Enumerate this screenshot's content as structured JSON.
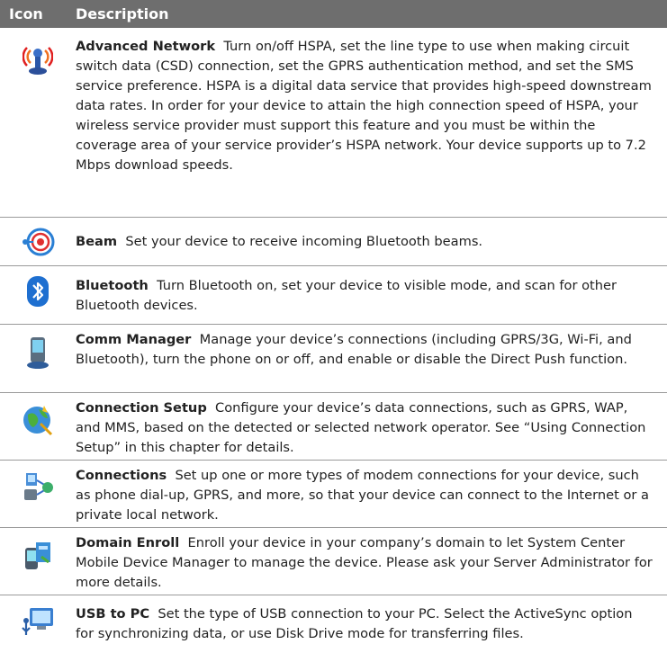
{
  "header": {
    "icon_label": "Icon",
    "description_label": "Description"
  },
  "items": [
    {
      "icon": "advanced-network-icon",
      "title": "Advanced Network",
      "text": "Turn on/off HSPA, set the line type to use when making circuit switch data (CSD) connection, set the GPRS authentication method, and set the SMS service preference. HSPA is a digital data service that provides high-speed downstream data rates. In order for your device to attain the high connection speed of HSPA, your wireless service provider must support this feature and you must be within the coverage area of your service provider’s HSPA network. Your device supports up to 7.2 Mbps download speeds."
    },
    {
      "icon": "beam-icon",
      "title": "Beam",
      "text": "Set your device to receive incoming Bluetooth beams."
    },
    {
      "icon": "bluetooth-icon",
      "title": "Bluetooth",
      "text": "Turn Bluetooth on, set your device to visible mode, and scan for other Bluetooth devices."
    },
    {
      "icon": "comm-manager-icon",
      "title": "Comm Manager",
      "text": "Manage your device’s connections (including GPRS/3G, Wi-Fi, and Bluetooth), turn the phone on or off, and enable or disable the Direct Push function."
    },
    {
      "icon": "connection-setup-icon",
      "title": "Connection Setup",
      "text": "Configure your device’s data connections, such as GPRS, WAP, and MMS, based on the detected or selected network operator. See “Using Connection Setup” in this chapter for details."
    },
    {
      "icon": "connections-icon",
      "title": "Connections",
      "text": "Set up one or more types of modem connections for your device, such as phone dial-up, GPRS, and more, so that your device can connect to the Internet or a private local network."
    },
    {
      "icon": "domain-enroll-icon",
      "title": "Domain Enroll",
      "text": "Enroll your device in your company’s domain to let System Center Mobile Device Manager to manage the device. Please ask your Server Administrator for more details."
    },
    {
      "icon": "usb-to-pc-icon",
      "title": "USB to PC",
      "text": "Set the type of USB connection to your PC. Select the ActiveSync option for synchronizing data, or use Disk Drive mode for transferring files."
    }
  ]
}
